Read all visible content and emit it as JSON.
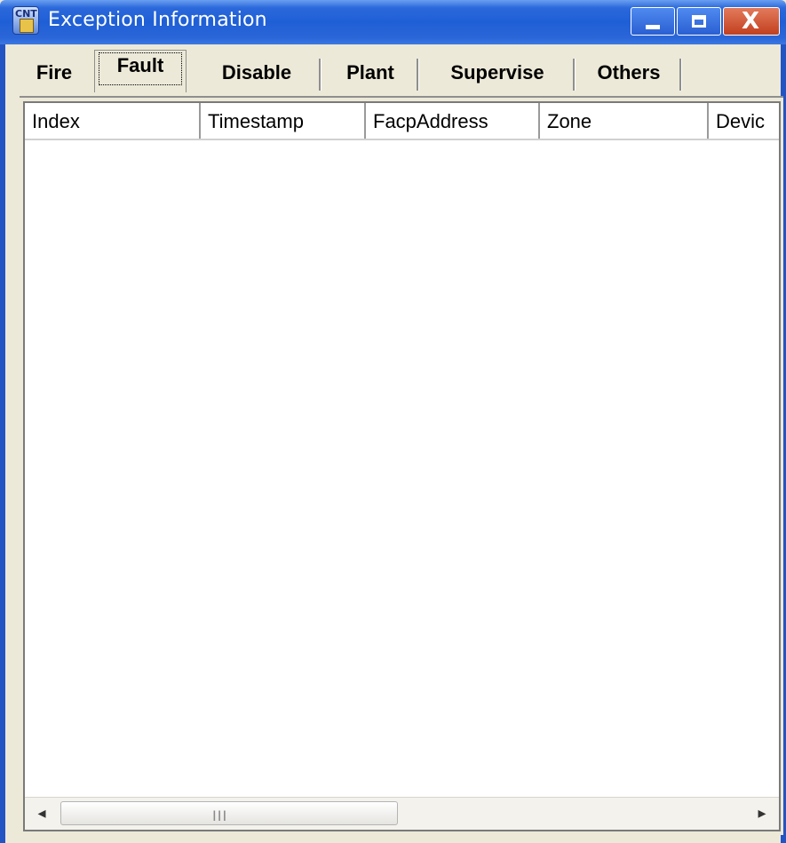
{
  "window": {
    "title": "Exception Information"
  },
  "app_icon": {
    "name": "app-icon",
    "text": "CNT"
  },
  "title_buttons": {
    "minimize": "minimize-icon",
    "maximize": "maximize-icon",
    "close": "X"
  },
  "tabs": [
    {
      "label": "Fire",
      "active": false
    },
    {
      "label": "Fault",
      "active": true
    },
    {
      "label": "Disable",
      "active": false
    },
    {
      "label": "Plant",
      "active": false
    },
    {
      "label": "Supervise",
      "active": false
    },
    {
      "label": "Others",
      "active": false
    }
  ],
  "table": {
    "columns": [
      "Index",
      "Timestamp",
      "FacpAddress",
      "Zone",
      "Devic"
    ],
    "rows": []
  },
  "scrollbar": {
    "left_arrow": "◂",
    "right_arrow": "▸",
    "grip": "III"
  },
  "colors": {
    "title_bar": "#1f5fd6",
    "window_bg": "#ece9d8",
    "close_button": "#c2401e"
  }
}
